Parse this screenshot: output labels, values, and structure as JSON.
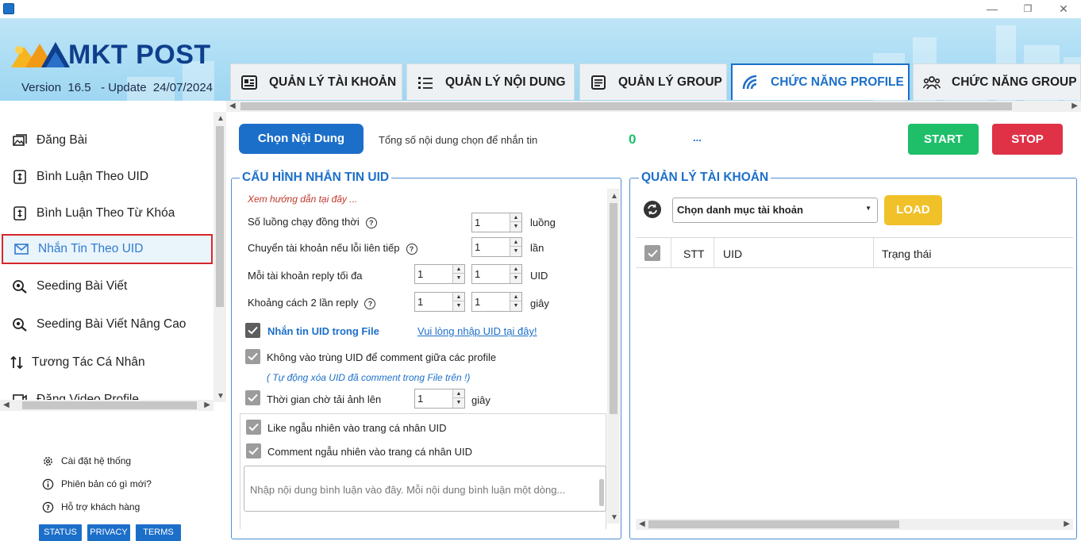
{
  "app": {
    "logo_text": "MKT POST",
    "version_line": "Version  16.5   - Update  24/07/2024"
  },
  "window": {
    "minimize": "—",
    "restore": "❐",
    "close": "✕"
  },
  "tabs": [
    {
      "label": "QUẢN LÝ TÀI KHOẢN",
      "icon": "account-card-icon",
      "active": false
    },
    {
      "label": "QUẢN LÝ NỘI DUNG",
      "icon": "list-icon",
      "active": false
    },
    {
      "label": "QUẢN LÝ GROUP",
      "icon": "document-icon",
      "active": false
    },
    {
      "label": "CHỨC NĂNG PROFILE",
      "icon": "wifi-signal-icon",
      "active": true
    },
    {
      "label": "CHỨC NĂNG GROUP",
      "icon": "group-icon",
      "active": false
    }
  ],
  "sidebar": {
    "items": [
      {
        "label": "Đăng Bài",
        "icon": "image-post-icon"
      },
      {
        "label": "Bình Luận Theo UID",
        "icon": "sort-updown-icon"
      },
      {
        "label": "Bình Luận Theo Từ Khóa",
        "icon": "sort-updown-icon"
      },
      {
        "label": "Nhắn Tin Theo UID",
        "icon": "mail-icon",
        "active": true
      },
      {
        "label": "Seeding Bài Viết",
        "icon": "search-eye-icon"
      },
      {
        "label": "Seeding Bài Viết Nâng Cao",
        "icon": "search-eye-icon"
      },
      {
        "label": "Tương Tác Cá Nhân",
        "icon": "arrows-updown-icon"
      },
      {
        "label": "Đăng Video Profile",
        "icon": "video-icon"
      }
    ],
    "footer": [
      {
        "label": "Cài đặt hệ thống",
        "icon": "gear-icon"
      },
      {
        "label": "Phiên bản có gì mới?",
        "icon": "info-icon"
      },
      {
        "label": "Hỗ trợ khách hàng",
        "icon": "help-icon"
      }
    ],
    "badges": [
      "STATUS",
      "PRIVACY",
      "TERMS"
    ]
  },
  "top": {
    "choose_content": "Chọn Nội Dung",
    "total_label": "Tổng số nội dung chọn để nhắn tin",
    "total_count": "0",
    "ellipsis": "...",
    "start": "START",
    "stop": "STOP"
  },
  "config": {
    "title": "CẤU HÌNH NHẮN TIN UID",
    "guide": "Xem hướng dẫn tại đây ...",
    "threads_label": "Số luồng chạy đồng thời",
    "threads_value": "1",
    "threads_unit": "luồng",
    "switch_label": "Chuyển tài khoản nếu lỗi liên tiếp",
    "switch_value": "1",
    "switch_unit": "lần",
    "reply_label": "Mỗi tài khoản reply tối đa",
    "reply_min": "1",
    "reply_max": "1",
    "reply_unit": "UID",
    "gap_label": "Khoảng cách 2 lần reply",
    "gap_min": "1",
    "gap_max": "1",
    "gap_unit": "giây",
    "uid_file_label": "Nhắn tin UID trong File",
    "uid_file_link": "Vui lòng nhập UID tại đây!",
    "no_dup_label": "Không vào trùng UID để comment giữa các profile",
    "auto_delete_note": "( Tự động xóa UID đã comment trong File trên !)",
    "wait_label": "Thời gian chờ tải ảnh lên",
    "wait_value": "1",
    "wait_unit": "giây",
    "like_label": "Like ngẫu nhiên vào trang cá nhân UID",
    "comment_label": "Comment ngẫu nhiên vào trang cá nhân UID",
    "comment_placeholder": "Nhập nội dung bình luận vào đây. Mỗi nội dung bình luận một dòng..."
  },
  "accounts": {
    "title": "QUẢN LÝ TÀI KHOẢN",
    "category_select": "Chọn danh mục tài khoản",
    "load": "LOAD",
    "columns": [
      "STT",
      "UID",
      "Trạng thái"
    ]
  },
  "colors": {
    "accent": "#1c6fc9",
    "start": "#1fbf6a",
    "stop": "#df3247",
    "load": "#f1c12a",
    "active_border": "#d6262a"
  }
}
